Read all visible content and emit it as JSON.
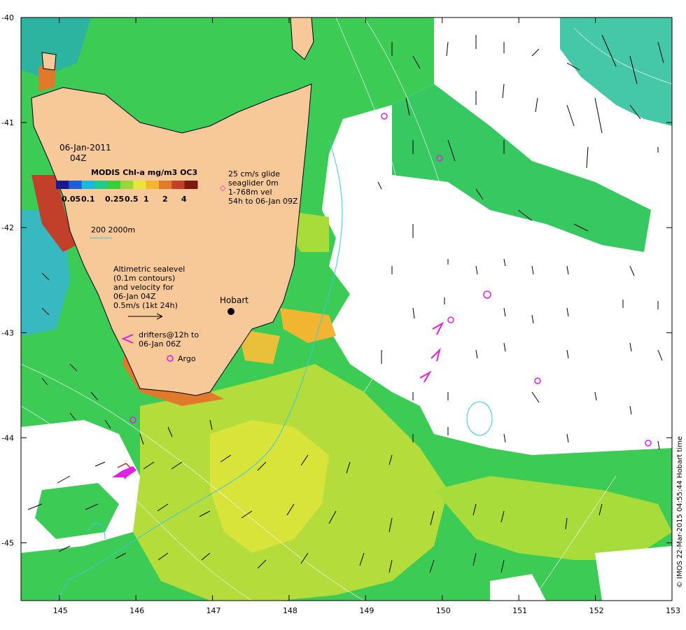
{
  "map": {
    "date": "06-Jan-2011",
    "hour": "04Z",
    "colorbar_title": "MODIS Chl-a mg/m3 OC3",
    "colorbar_ticks": [
      "0.05",
      "0.1",
      "0.25",
      "0.5",
      "1",
      "2",
      "4"
    ],
    "colorbar_colors": [
      "#1a1a8c",
      "#1f5fd6",
      "#1fb6d9",
      "#22c98a",
      "#3ccc3a",
      "#9ad63a",
      "#e8e63a",
      "#f2b531",
      "#e07a2a",
      "#c2402a",
      "#7a1a14"
    ],
    "contour_legend": "200  2000m",
    "glider_lines": [
      "25 cm/s glide",
      "seaglider 0m",
      "1-768m vel",
      "54h to 06-Jan 09Z"
    ],
    "sealevel_lines": [
      "Altimetric sealevel",
      "(0.1m contours)",
      "and velocity for",
      "06-Jan 04Z",
      "0.5m/s (1kt 24h)"
    ],
    "drifter_lines": [
      "drifters@12h to",
      "06-Jan 06Z"
    ],
    "argo_label": "Argo",
    "city": "Hobart",
    "x_ticks": [
      "145",
      "146",
      "147",
      "148",
      "149",
      "150",
      "151",
      "152",
      "153"
    ],
    "y_ticks": [
      "-40",
      "-41",
      "-42",
      "-43",
      "-44",
      "-45"
    ],
    "credit": "© IMOS 22-Mar-2015 04:55:44 Hobart time",
    "colors": {
      "land": "#f7c999",
      "ocean_green": "#3ccc55",
      "ocean_yellow": "#c8e23a",
      "cyan": "#3cc8e0",
      "argo": "#e020e0"
    }
  }
}
